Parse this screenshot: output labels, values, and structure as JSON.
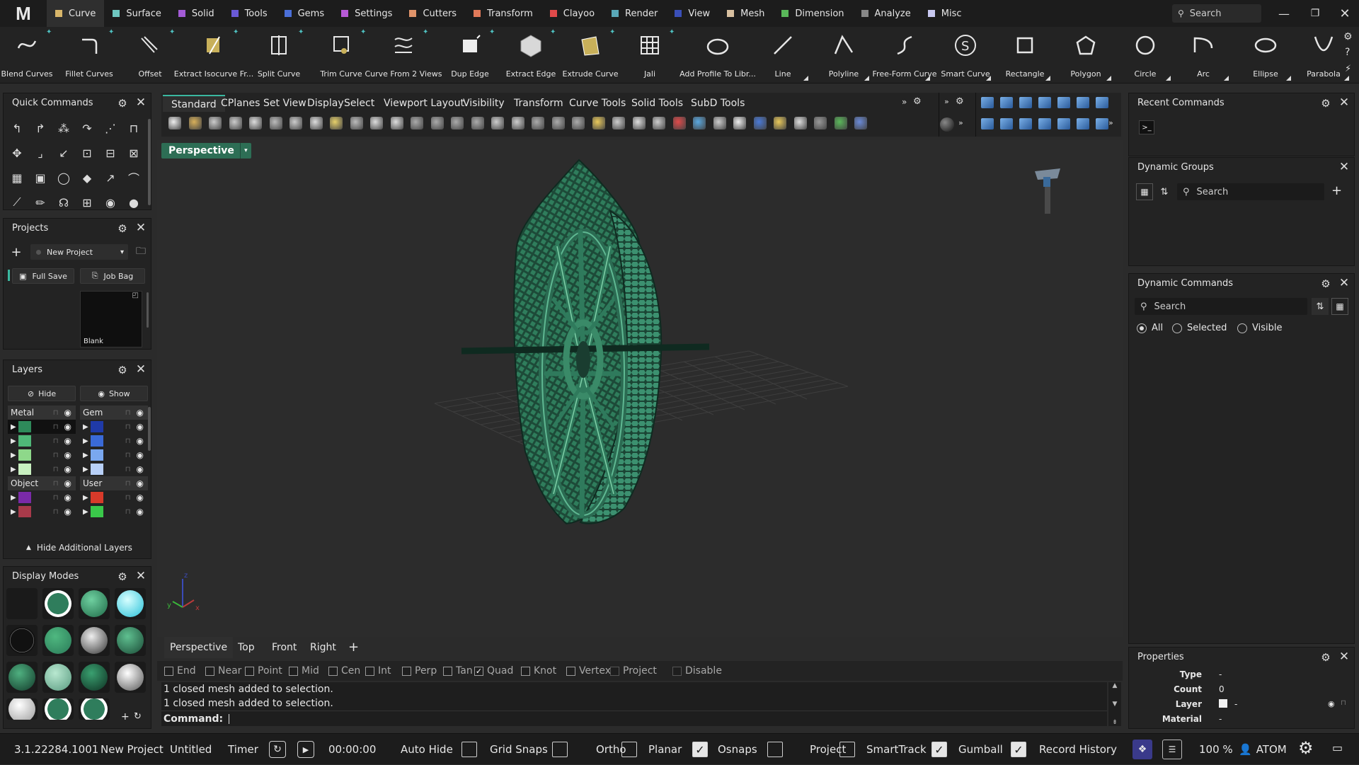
{
  "app": {
    "logo": "M"
  },
  "menu": [
    {
      "label": "Curve",
      "color": "#d8b66a",
      "active": true
    },
    {
      "label": "Surface",
      "color": "#6fc7c0"
    },
    {
      "label": "Solid",
      "color": "#a35bd6"
    },
    {
      "label": "Tools",
      "color": "#6a5ad6"
    },
    {
      "label": "Gems",
      "color": "#4b6fd8"
    },
    {
      "label": "Settings",
      "color": "#b75ad6"
    },
    {
      "label": "Cutters",
      "color": "#e0946a"
    },
    {
      "label": "Transform",
      "color": "#e07a5a"
    },
    {
      "label": "Clayoo",
      "color": "#e04a4a"
    },
    {
      "label": "Render",
      "color": "#5aa8b8"
    },
    {
      "label": "View",
      "color": "#3a4fb8"
    },
    {
      "label": "Mesh",
      "color": "#d8c0a0"
    },
    {
      "label": "Dimension",
      "color": "#5ab85a"
    },
    {
      "label": "Analyze",
      "color": "#888888"
    },
    {
      "label": "Misc",
      "color": "#c8c8f0"
    }
  ],
  "top_search": {
    "placeholder": "Search"
  },
  "ribbon": [
    {
      "label": "Blend Curves",
      "icon": "blend-curves-icon"
    },
    {
      "label": "Fillet Curves",
      "icon": "fillet-curves-icon"
    },
    {
      "label": "Offset",
      "icon": "offset-icon"
    },
    {
      "label": "Extract Isocurve Fr...",
      "icon": "extract-isocurve-icon"
    },
    {
      "label": "Split Curve",
      "icon": "split-curve-icon"
    },
    {
      "label": "Trim Curve",
      "icon": "trim-curve-icon"
    },
    {
      "label": "Curve From 2 Views",
      "icon": "curve-from-2-views-icon"
    },
    {
      "label": "Dup Edge",
      "icon": "dup-edge-icon"
    },
    {
      "label": "Extract Edge",
      "icon": "extract-edge-icon"
    },
    {
      "label": "Extrude Curve",
      "icon": "extrude-curve-icon"
    },
    {
      "label": "Jali",
      "icon": "jali-icon"
    },
    {
      "label": "Add Profile To Libr...",
      "icon": "add-profile-icon"
    },
    {
      "label": "Line",
      "icon": "line-icon"
    },
    {
      "label": "Polyline",
      "icon": "polyline-icon"
    },
    {
      "label": "Free-Form Curve",
      "icon": "free-form-curve-icon"
    },
    {
      "label": "Smart Curve",
      "icon": "smart-curve-icon"
    },
    {
      "label": "Rectangle",
      "icon": "rectangle-icon"
    },
    {
      "label": "Polygon",
      "icon": "polygon-icon"
    },
    {
      "label": "Circle",
      "icon": "circle-icon"
    },
    {
      "label": "Arc",
      "icon": "arc-icon"
    },
    {
      "label": "Ellipse",
      "icon": "ellipse-icon"
    },
    {
      "label": "Parabola",
      "icon": "parabola-icon"
    }
  ],
  "quick_commands": {
    "title": "Quick Commands"
  },
  "projects": {
    "title": "Projects",
    "selected": "New Project",
    "full_save": "Full Save",
    "job_bag": "Job Bag",
    "thumb_label": "Blank"
  },
  "layers": {
    "title": "Layers",
    "hide": "Hide",
    "show": "Show",
    "groups": [
      {
        "name": "Metal",
        "colors": [
          "#2e8a5a",
          "#4fb878",
          "#8ed88a",
          "#c8f0c0"
        ]
      },
      {
        "name": "Gem",
        "colors": [
          "#1f3aa8",
          "#3a6ad8",
          "#7aa8f0",
          "#b8d0f8"
        ]
      },
      {
        "name": "Object",
        "colors": [
          "#7a2aa8",
          "#a83a4a"
        ]
      },
      {
        "name": "User",
        "colors": [
          "#d83a2a",
          "#3ac84a"
        ]
      }
    ],
    "more": "Hide Additional Layers"
  },
  "display_modes": {
    "title": "Display Modes"
  },
  "viewport_tabs": [
    "Standard",
    "CPlanes",
    "Set View",
    "Display",
    "Select",
    "Viewport Layout",
    "Visibility",
    "Transform",
    "Curve Tools",
    "Solid Tools",
    "SubD Tools"
  ],
  "viewport": {
    "active": "Perspective"
  },
  "bottom_tabs": [
    "Perspective",
    "Top",
    "Front",
    "Right"
  ],
  "osnaps": [
    {
      "label": "End",
      "checked": false
    },
    {
      "label": "Near",
      "checked": false
    },
    {
      "label": "Point",
      "checked": false
    },
    {
      "label": "Mid",
      "checked": false
    },
    {
      "label": "Cen",
      "checked": false
    },
    {
      "label": "Int",
      "checked": false
    },
    {
      "label": "Perp",
      "checked": false
    },
    {
      "label": "Tan",
      "checked": false
    },
    {
      "label": "Quad",
      "checked": true
    },
    {
      "label": "Knot",
      "checked": false
    },
    {
      "label": "Vertex",
      "checked": false
    },
    {
      "label": "Project",
      "checked": false
    },
    {
      "label": "Disable",
      "checked": false
    }
  ],
  "command": {
    "history": [
      "1 closed mesh added to selection.",
      "1 closed mesh added to selection."
    ],
    "prompt": "Command:"
  },
  "status": {
    "version": "3.1.22284.1001",
    "project": "New Project",
    "file": "Untitled",
    "timer_label": "Timer",
    "timer": "00:00:00",
    "zoom": "100 %",
    "user": "ATOM",
    "toggles": [
      {
        "label": "Auto Hide",
        "checked": false
      },
      {
        "label": "Grid Snaps",
        "checked": false
      },
      {
        "label": "Ortho",
        "checked": false
      },
      {
        "label": "Planar",
        "checked": true
      },
      {
        "label": "Osnaps",
        "checked": false
      },
      {
        "label": "Project",
        "checked": false
      },
      {
        "label": "SmartTrack",
        "checked": true
      },
      {
        "label": "Gumball",
        "checked": true
      },
      {
        "label": "Record History",
        "checked": false
      }
    ]
  },
  "right": {
    "recent_title": "Recent Commands",
    "groups_title": "Dynamic Groups",
    "groups_search": "Search",
    "commands_title": "Dynamic Commands",
    "commands_search": "Search",
    "filter": [
      {
        "label": "All",
        "on": true
      },
      {
        "label": "Selected",
        "on": false
      },
      {
        "label": "Visible",
        "on": false
      }
    ],
    "properties_title": "Properties",
    "properties": [
      {
        "key": "Type",
        "value": "-"
      },
      {
        "key": "Count",
        "value": "0"
      },
      {
        "key": "Layer",
        "value": "-"
      },
      {
        "key": "Material",
        "value": "-"
      }
    ]
  }
}
